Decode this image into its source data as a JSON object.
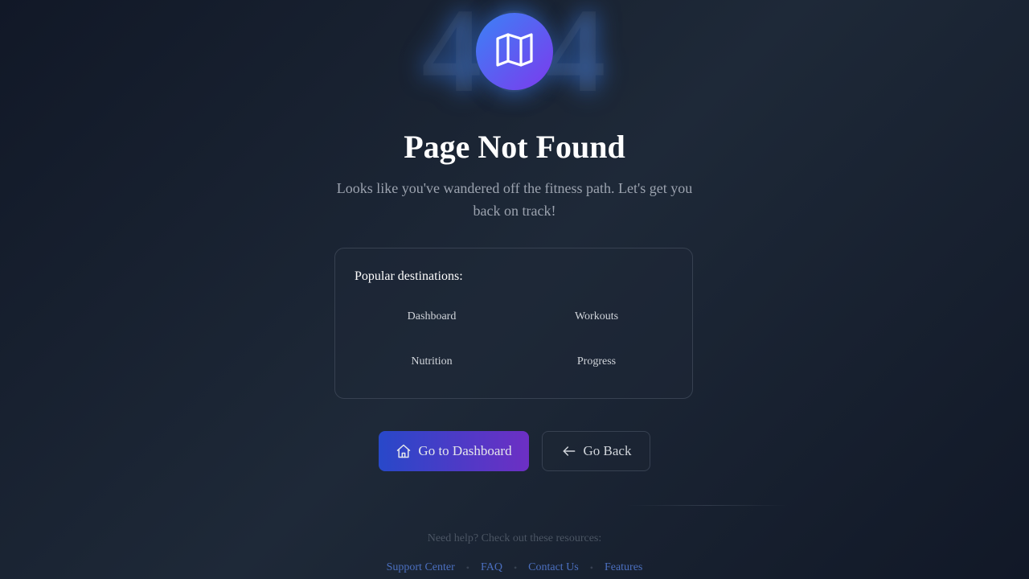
{
  "hero": {
    "background_code": "404",
    "badge_icon": "map-icon"
  },
  "title": "Page Not Found",
  "subtitle": "Looks like you've wandered off the fitness path. Let's get you back on track!",
  "destinations": {
    "heading": "Popular destinations:",
    "items": [
      {
        "label": "Dashboard"
      },
      {
        "label": "Workouts"
      },
      {
        "label": "Nutrition"
      },
      {
        "label": "Progress"
      }
    ]
  },
  "actions": {
    "primary": {
      "label": "Go to Dashboard",
      "icon": "home-icon"
    },
    "secondary": {
      "label": "Go Back",
      "icon": "arrow-left-icon"
    }
  },
  "help": {
    "text": "Need help? Check out these resources:",
    "links": [
      {
        "label": "Support Center"
      },
      {
        "label": "FAQ"
      },
      {
        "label": "Contact Us"
      },
      {
        "label": "Features"
      }
    ],
    "separator": "•"
  },
  "colors": {
    "background": "#111827",
    "accent_blue": "#3b82f6",
    "accent_purple": "#7c3aed",
    "muted_text": "#9ca3af",
    "link": "#4b6fbf"
  }
}
